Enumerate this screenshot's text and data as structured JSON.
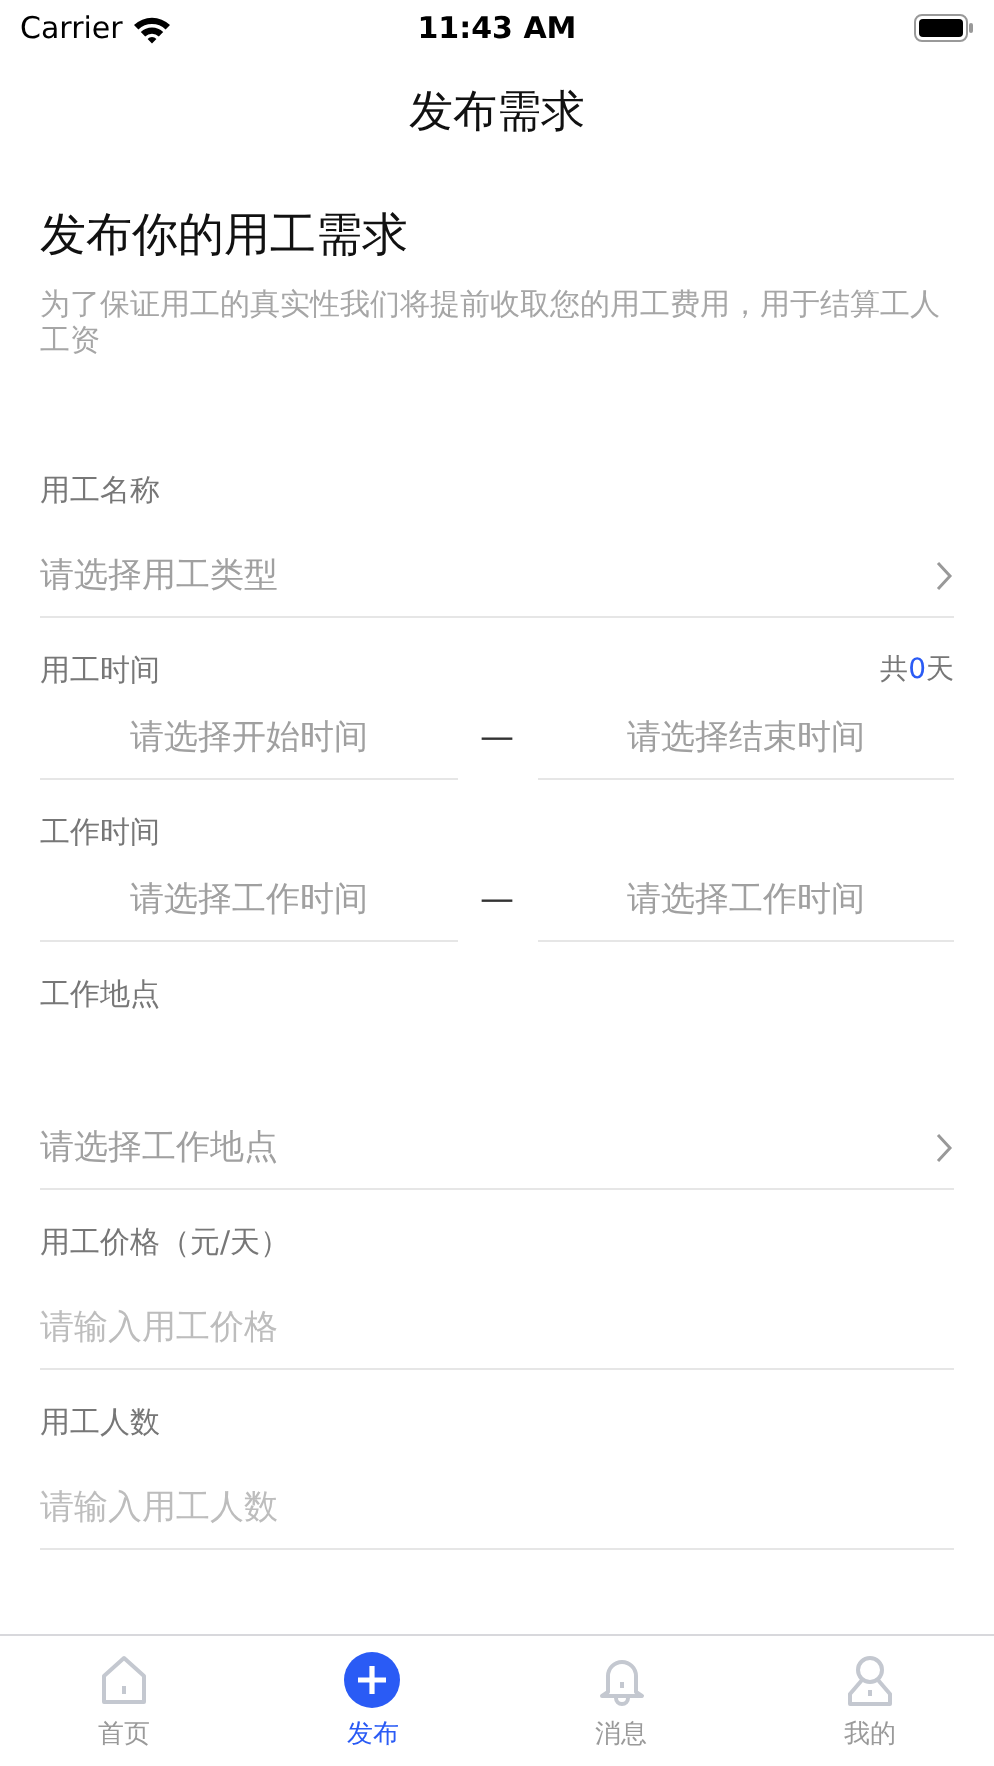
{
  "status_bar": {
    "carrier": "Carrier",
    "time": "11:43 AM"
  },
  "nav": {
    "title": "发布需求"
  },
  "intro": {
    "heading": "发布你的用工需求",
    "note": "为了保证用工的真实性我们将提前收取您的用工费用，用于结算工人工资"
  },
  "fields": [
    {
      "kind": "select",
      "label": "用工名称",
      "placeholder": "请选择用工类型"
    },
    {
      "kind": "range",
      "label": "用工时间",
      "total": {
        "prefix": "共",
        "count": "0",
        "suffix": "天"
      },
      "start_placeholder": "请选择开始时间",
      "separator": "—",
      "end_placeholder": "请选择结束时间"
    },
    {
      "kind": "range",
      "label": "工作时间",
      "start_placeholder": "请选择工作时间",
      "separator": "—",
      "end_placeholder": "请选择工作时间"
    },
    {
      "kind": "select",
      "label": "工作地点",
      "placeholder": "请选择工作地点"
    },
    {
      "kind": "input",
      "label": "用工价格（元/天）",
      "placeholder": "请输入用工价格"
    },
    {
      "kind": "input",
      "label": "用工人数",
      "placeholder": "请输入用工人数"
    }
  ],
  "tabs": [
    {
      "kind": "home",
      "label": "首页",
      "selected": false
    },
    {
      "kind": "plus",
      "label": "发布",
      "selected": true
    },
    {
      "kind": "bell",
      "label": "消息",
      "selected": false
    },
    {
      "kind": "person",
      "label": "我的",
      "selected": false
    }
  ]
}
